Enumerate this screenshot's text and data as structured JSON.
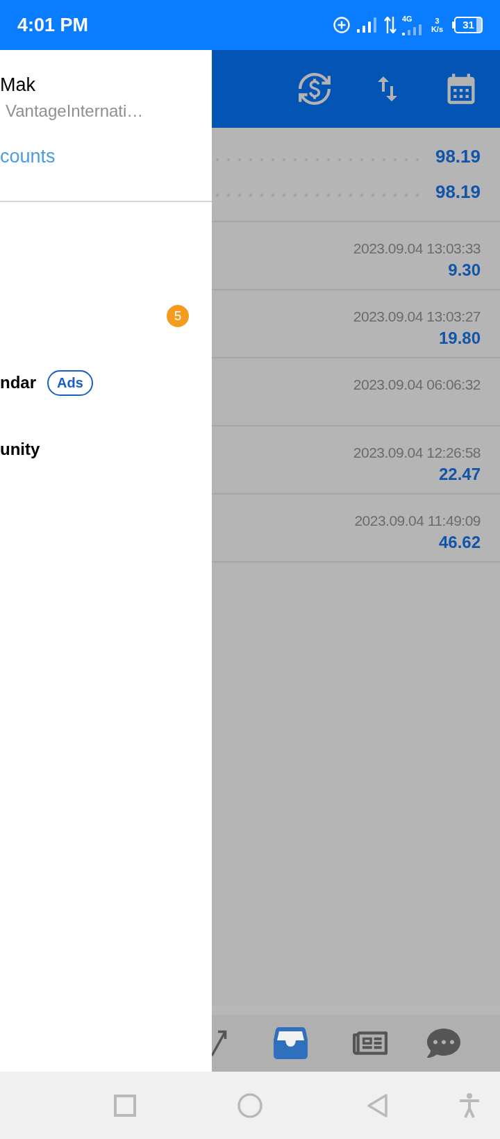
{
  "status_bar": {
    "time": "4:01 PM",
    "network_type": "4G",
    "speed_value": "3",
    "speed_unit": "K/s",
    "battery": "31"
  },
  "drawer": {
    "account_name": "Mak",
    "account_server": "VantageInternati…",
    "accounts_link": "counts",
    "menu_items": [
      {
        "badge": "5"
      },
      {
        "label": "ndar",
        "tag": "Ads"
      },
      {
        "label": "unity"
      }
    ]
  },
  "summary_rows": [
    {
      "value": "98.19"
    },
    {
      "value": "98.19"
    }
  ],
  "history_rows": [
    {
      "time": "2023.09.04 13:03:33",
      "value": "9.30"
    },
    {
      "time": "2023.09.04 13:03:27",
      "value": "19.80"
    },
    {
      "time": "2023.09.04 06:06:32"
    },
    {
      "time": "2023.09.04 12:26:58",
      "value": "22.47"
    },
    {
      "time": "2023.09.04 11:49:09",
      "value": "46.62"
    }
  ],
  "bottom_nav": [
    {
      "selected": false
    },
    {
      "selected": true
    },
    {
      "selected": false
    },
    {
      "selected": false
    }
  ]
}
